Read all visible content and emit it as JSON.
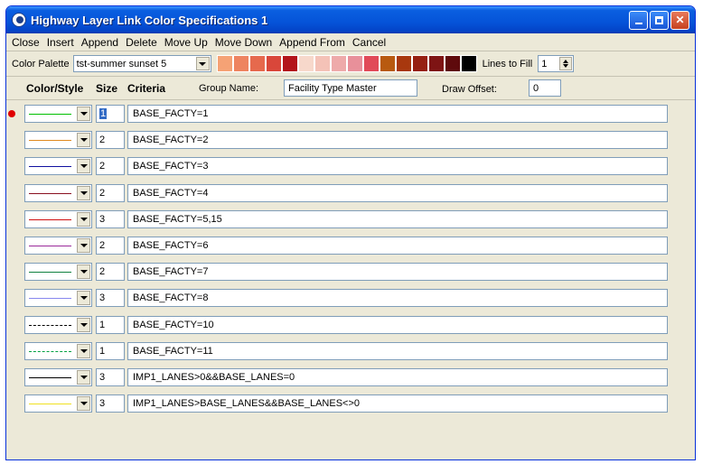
{
  "window": {
    "title": "Highway Layer Link Color Specifications 1"
  },
  "menu": [
    "Close",
    "Insert",
    "Append",
    "Delete",
    "Move Up",
    "Move Down",
    "Append From",
    "Cancel"
  ],
  "palette": {
    "label": "Color Palette",
    "selected": "tst-summer sunset 5",
    "swatches": [
      "#f5a275",
      "#ee8460",
      "#e6694d",
      "#d9473a",
      "#b3141b",
      "#f7d8cb",
      "#f4c2b7",
      "#eeaaaa",
      "#e8909a",
      "#e14a58",
      "#b85a10",
      "#a8380e",
      "#962012",
      "#7e1414",
      "#5e0a0c",
      "#000000"
    ],
    "lines_label": "Lines to Fill",
    "lines_value": "1"
  },
  "header": {
    "color_style": "Color/Style",
    "size": "Size",
    "criteria": "Criteria",
    "group_label": "Group Name:",
    "group_value": "Facility Type Master",
    "offset_label": "Draw Offset:",
    "offset_value": "0"
  },
  "rows": [
    {
      "color": "#00c000",
      "dash": "solid",
      "size": "1",
      "criteria": "BASE_FACTY=1",
      "active": true
    },
    {
      "color": "#e08a20",
      "dash": "solid",
      "size": "2",
      "criteria": "BASE_FACTY=2",
      "active": false
    },
    {
      "color": "#1010a0",
      "dash": "solid",
      "size": "2",
      "criteria": "BASE_FACTY=3",
      "active": false
    },
    {
      "color": "#8a1020",
      "dash": "solid",
      "size": "2",
      "criteria": "BASE_FACTY=4",
      "active": false
    },
    {
      "color": "#d01010",
      "dash": "solid",
      "size": "3",
      "criteria": "BASE_FACTY=5,15",
      "active": false
    },
    {
      "color": "#9a2a9a",
      "dash": "solid",
      "size": "2",
      "criteria": "BASE_FACTY=6",
      "active": false
    },
    {
      "color": "#108040",
      "dash": "solid",
      "size": "2",
      "criteria": "BASE_FACTY=7",
      "active": false
    },
    {
      "color": "#8888ee",
      "dash": "solid",
      "size": "3",
      "criteria": "BASE_FACTY=8",
      "active": false
    },
    {
      "color": "#000000",
      "dash": "dashed",
      "size": "1",
      "criteria": "BASE_FACTY=10",
      "active": false
    },
    {
      "color": "#00a040",
      "dash": "dashed",
      "size": "1",
      "criteria": "BASE_FACTY=11",
      "active": false
    },
    {
      "color": "#000000",
      "dash": "solid",
      "size": "3",
      "criteria": "IMP1_LANES>0&&BASE_LANES=0",
      "active": false
    },
    {
      "color": "#f0e020",
      "dash": "solid",
      "size": "3",
      "criteria": "IMP1_LANES>BASE_LANES&&BASE_LANES<>0",
      "active": false
    }
  ]
}
